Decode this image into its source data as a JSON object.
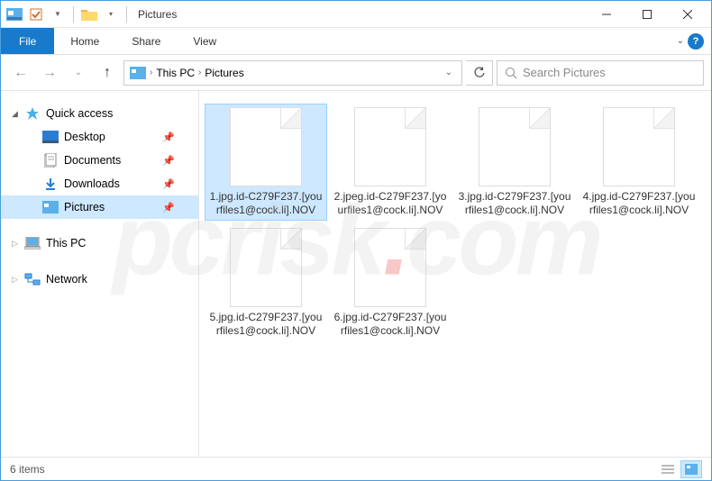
{
  "title": "Pictures",
  "ribbon": {
    "file": "File",
    "tabs": [
      "Home",
      "Share",
      "View"
    ]
  },
  "breadcrumb": {
    "parts": [
      "This PC",
      "Pictures"
    ]
  },
  "search": {
    "placeholder": "Search Pictures"
  },
  "sidebar": {
    "quick_access": {
      "label": "Quick access",
      "items": [
        {
          "label": "Desktop",
          "pinned": true,
          "icon": "desktop"
        },
        {
          "label": "Documents",
          "pinned": true,
          "icon": "documents"
        },
        {
          "label": "Downloads",
          "pinned": true,
          "icon": "downloads"
        },
        {
          "label": "Pictures",
          "pinned": true,
          "icon": "pictures",
          "selected": true
        }
      ]
    },
    "this_pc": {
      "label": "This PC"
    },
    "network": {
      "label": "Network"
    }
  },
  "files": [
    {
      "name": "1.jpg.id-C279F237.[yourfiles1@cock.li].NOV",
      "selected": true
    },
    {
      "name": "2.jpeg.id-C279F237.[yourfiles1@cock.li].NOV"
    },
    {
      "name": "3.jpg.id-C279F237.[yourfiles1@cock.li].NOV"
    },
    {
      "name": "4.jpg.id-C279F237.[yourfiles1@cock.li].NOV"
    },
    {
      "name": "5.jpg.id-C279F237.[yourfiles1@cock.li].NOV"
    },
    {
      "name": "6.jpg.id-C279F237.[yourfiles1@cock.li].NOV"
    }
  ],
  "status": {
    "text": "6 items"
  },
  "watermark": {
    "left": "pcrisk",
    "dot": ".",
    "right": "com"
  }
}
